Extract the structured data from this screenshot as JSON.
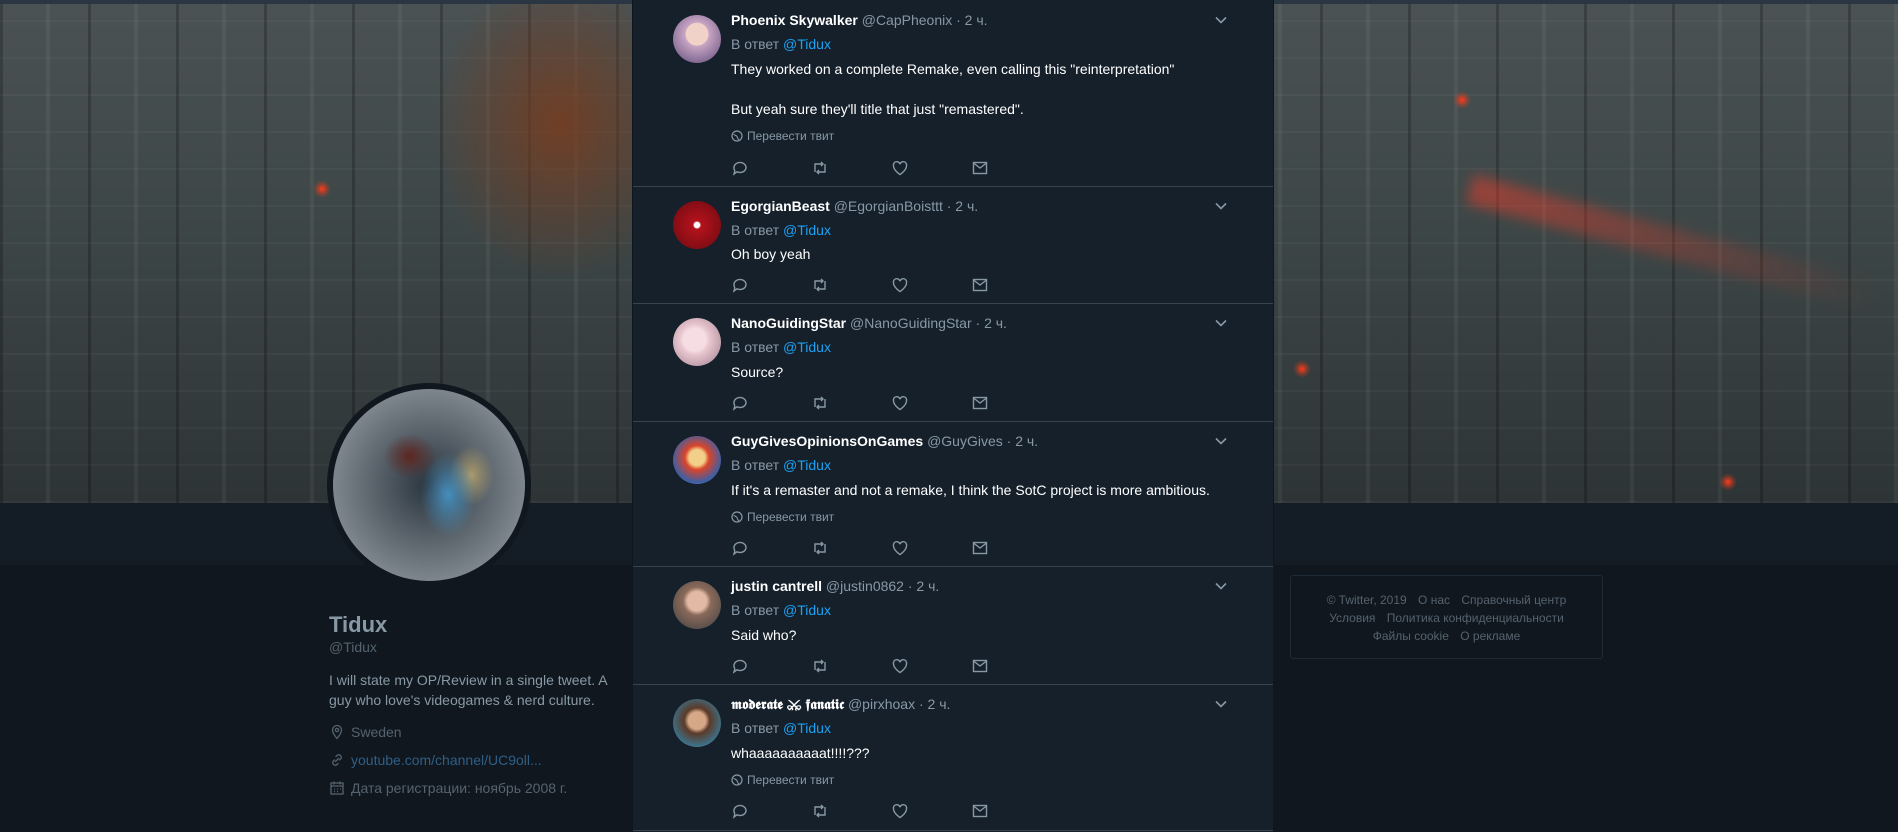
{
  "profile": {
    "name": "Tidux",
    "handle": "@Tidux",
    "bio": "I will state my OP/Review in a single tweet. A guy who love's videogames & nerd culture.",
    "location": "Sweden",
    "link": "youtube.com/channel/UC9oll...",
    "joined": "Дата регистрации: ноябрь 2008 г."
  },
  "labels": {
    "in_reply_to": "В ответ",
    "translate": "Перевести твит"
  },
  "tweets": [
    {
      "name": "Phoenix Skywalker",
      "handle": "@CapPheonix",
      "time": "· 2 ч.",
      "reply_to": "@Tidux",
      "text": "They worked on a complete Remake, even calling this \"reinterpretation\"\n\nBut yeah sure they'll title that just \"remastered\".",
      "avatar_color": "#c9a6c4"
    },
    {
      "name": "EgorgianBeast",
      "handle": "@EgorgianBoisttt",
      "time": "· 2 ч.",
      "reply_to": "@Tidux",
      "text": "Oh boy yeah",
      "avatar_color": "#b3121c"
    },
    {
      "name": "NanoGuidingStar",
      "handle": "@NanoGuidingStar",
      "time": "· 2 ч.",
      "reply_to": "@Tidux",
      "text": "Source?",
      "avatar_color": "#e8c6cf"
    },
    {
      "name": "GuyGivesOpinionsOnGames",
      "handle": "@GuyGives",
      "time": "· 2 ч.",
      "reply_to": "@Tidux",
      "text": "If it's a remaster and not a remake, I think the SotC project is more ambitious.",
      "avatar_color": "#d9452b"
    },
    {
      "name": "justin cantrell",
      "handle": "@justin0862",
      "time": "· 2 ч.",
      "reply_to": "@Tidux",
      "text": "Said who?",
      "avatar_color": "#8a6a5a"
    },
    {
      "name": "𝖒𝖔𝖉𝖊𝖗𝖆𝖙𝖊 ⚔ 𝖋𝖆𝖓𝖆𝖙𝖎𝖈",
      "handle": "@pirxhoax",
      "time": "· 2 ч.",
      "reply_to": "@Tidux",
      "text": "whaaaaaaaaaat!!!!???",
      "avatar_color": "#3e6f86"
    }
  ],
  "footer": {
    "items": [
      "© Twitter, 2019",
      "О нас",
      "Справочный центр",
      "Условия",
      "Политика конфиденциальности",
      "Файлы cookie",
      "О рекламе"
    ]
  },
  "colors": {
    "accent": "#1da1f2",
    "background": "#15202b",
    "muted": "#8899a6"
  }
}
